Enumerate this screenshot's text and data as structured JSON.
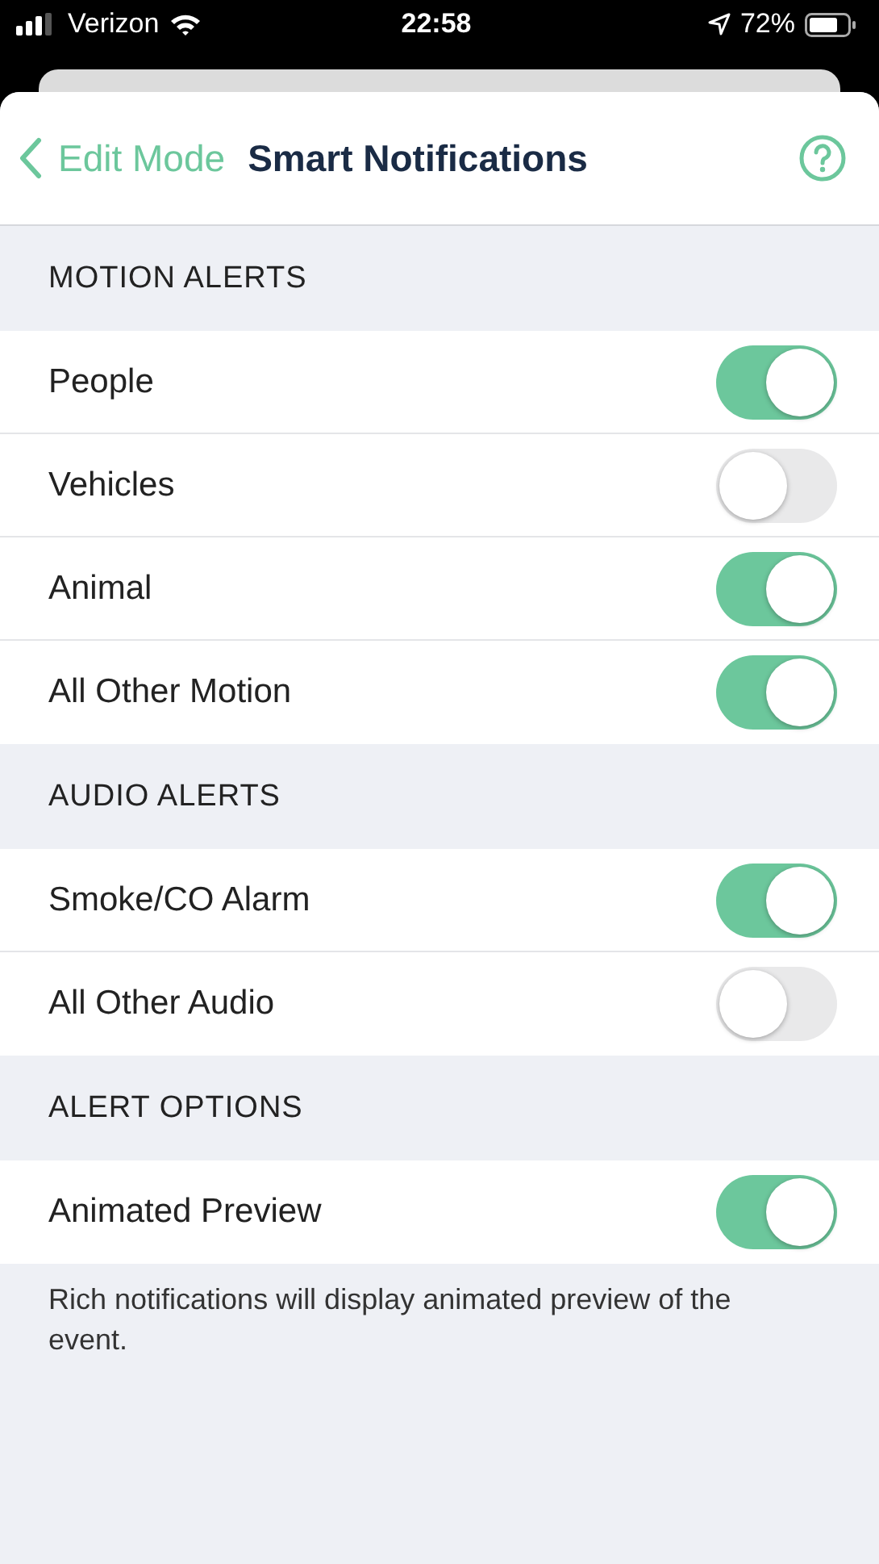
{
  "status_bar": {
    "carrier": "Verizon",
    "time": "22:58",
    "battery": "72%"
  },
  "nav": {
    "back": "Edit Mode",
    "title": "Smart Notifications"
  },
  "sections": [
    {
      "title": "MOTION ALERTS",
      "items": [
        {
          "label": "People",
          "on": true
        },
        {
          "label": "Vehicles",
          "on": false
        },
        {
          "label": "Animal",
          "on": true
        },
        {
          "label": "All Other Motion",
          "on": true
        }
      ]
    },
    {
      "title": "AUDIO ALERTS",
      "items": [
        {
          "label": "Smoke/CO Alarm",
          "on": true
        },
        {
          "label": "All Other Audio",
          "on": false
        }
      ]
    },
    {
      "title": "ALERT OPTIONS",
      "items": [
        {
          "label": "Animated Preview",
          "on": true
        }
      ]
    }
  ],
  "footer": "Rich notifications will display animated preview of the event."
}
